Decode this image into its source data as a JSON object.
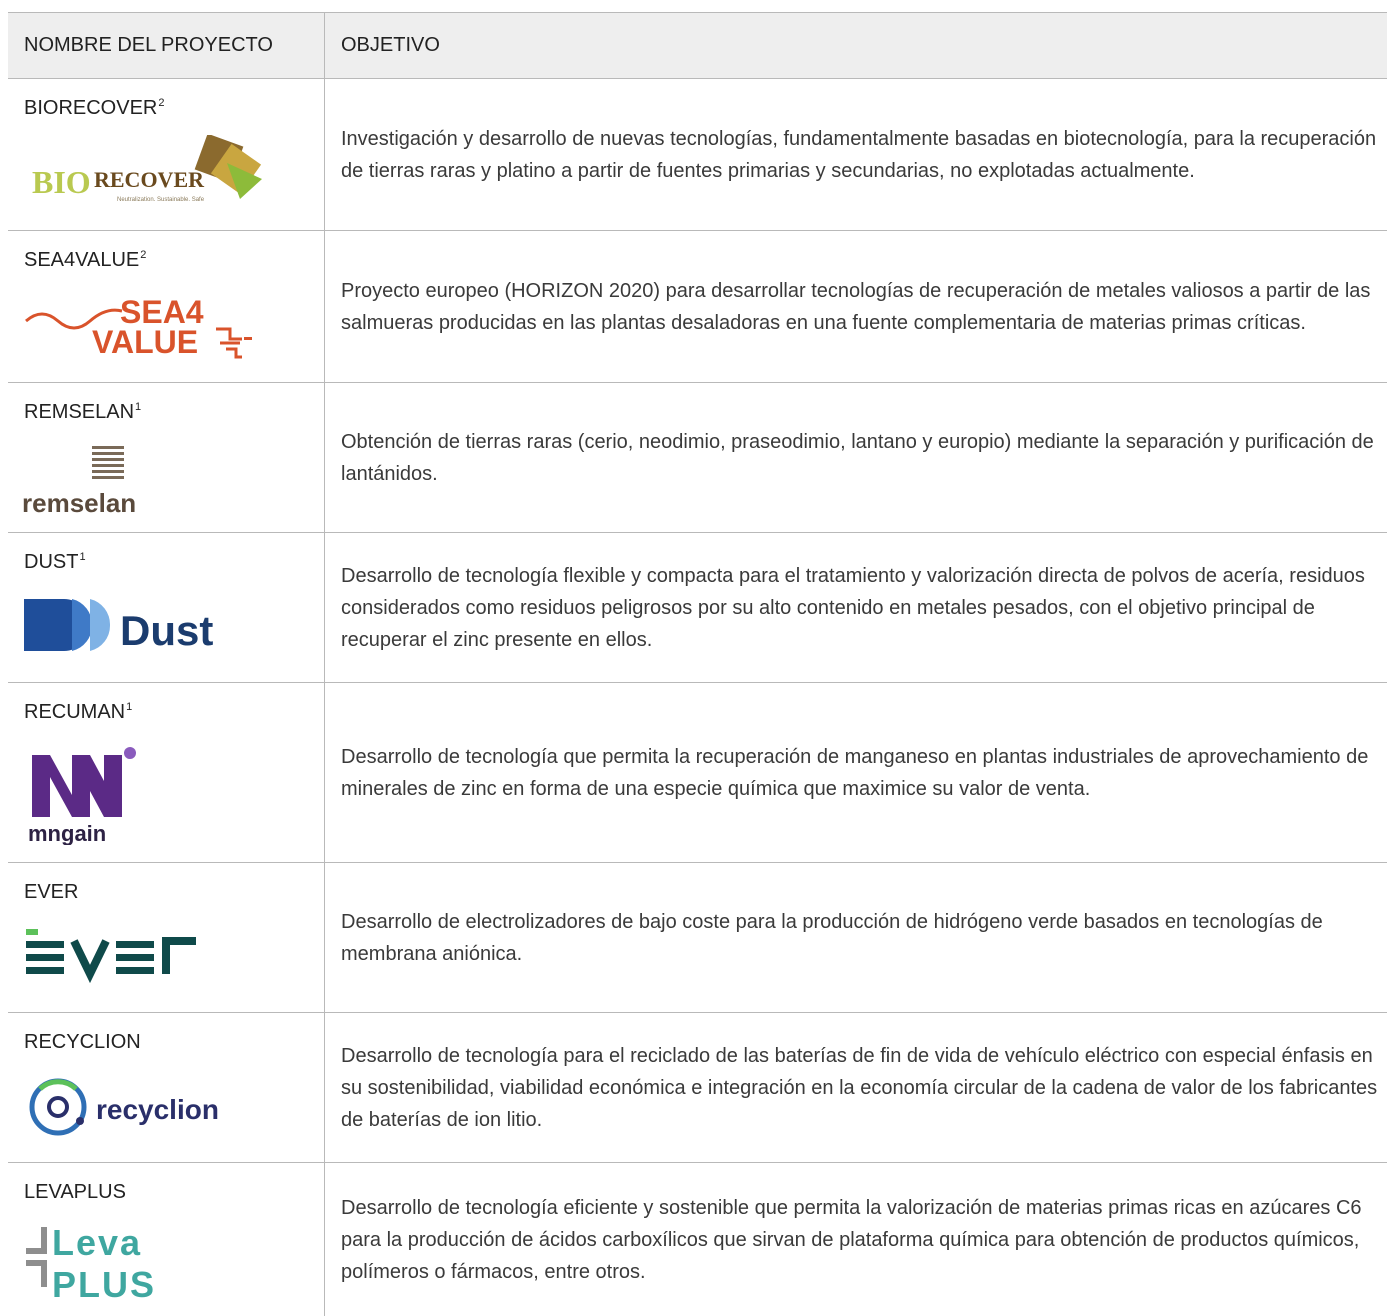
{
  "header": {
    "col_name": "NOMBRE DEL PROYECTO",
    "col_objective": "OBJETIVO"
  },
  "rows": [
    {
      "name": "BIORECOVER",
      "sup": "2",
      "logo": "biorecover-logo",
      "logo_text": "BIORECOVER",
      "objective": "Investigación y desarrollo de nuevas tecnologías, fundamentalmente basadas en biotecnología, para la recuperación de tierras raras y platino a partir de fuentes primarias y secundarias, no explotadas actualmente."
    },
    {
      "name": "SEA4VALUE",
      "sup": "2",
      "logo": "sea4value-logo",
      "logo_text": "SEA4 VALUE",
      "objective": "Proyecto europeo (HORIZON 2020) para desarrollar tecnologías de recuperación de metales valiosos a partir de las salmueras producidas en las plantas desaladoras en una fuente complementaria de materias primas críticas."
    },
    {
      "name": "REMSELAN",
      "sup": "1",
      "logo": "remselan-logo",
      "logo_text": "remselan",
      "objective": "Obtención de tierras raras (cerio, neodimio, praseodimio, lantano y europio) mediante la separación y purificación de lantánidos."
    },
    {
      "name": "DUST",
      "sup": "1",
      "logo": "dust-logo",
      "logo_text": "Dust",
      "objective": "Desarrollo de tecnología flexible y compacta para el tratamiento y valorización directa de polvos de acería, residuos considerados como residuos peligrosos por su alto contenido en metales pesados, con el objetivo principal de recuperar el zinc presente en ellos."
    },
    {
      "name": "RECUMAN",
      "sup": "1",
      "logo": "mngain-logo",
      "logo_text": "mngain",
      "objective": "Desarrollo de tecnología que permita la recuperación de manganeso en plantas industriales de aprovechamiento de minerales de zinc en forma de una especie química que maximice su valor de venta."
    },
    {
      "name": "EVER",
      "sup": "",
      "logo": "ever-logo",
      "logo_text": "EVER",
      "objective": "Desarrollo de electrolizadores de bajo coste para la producción de hidrógeno verde basados en tecnologías de membrana aniónica."
    },
    {
      "name": "RECYCLION",
      "sup": "",
      "logo": "recyclion-logo",
      "logo_text": "recyclion",
      "objective": "Desarrollo de tecnología para el reciclado de las baterías de fin de vida de vehículo eléctrico con especial énfasis en su sostenibilidad, viabilidad económica e integración en la economía circular de la cadena de valor de los fabricantes de baterías de ion litio."
    },
    {
      "name": "LEVAPLUS",
      "sup": "",
      "logo": "levaplus-logo",
      "logo_text": "LEVA PLUS",
      "objective": "Desarrollo de tecnología eficiente y sostenible que permita la valorización de materias primas ricas en azúcares C6 para la producción de ácidos carboxílicos que sirvan de plataforma química para obtención de productos químicos, polímeros o fármacos, entre otros."
    }
  ]
}
